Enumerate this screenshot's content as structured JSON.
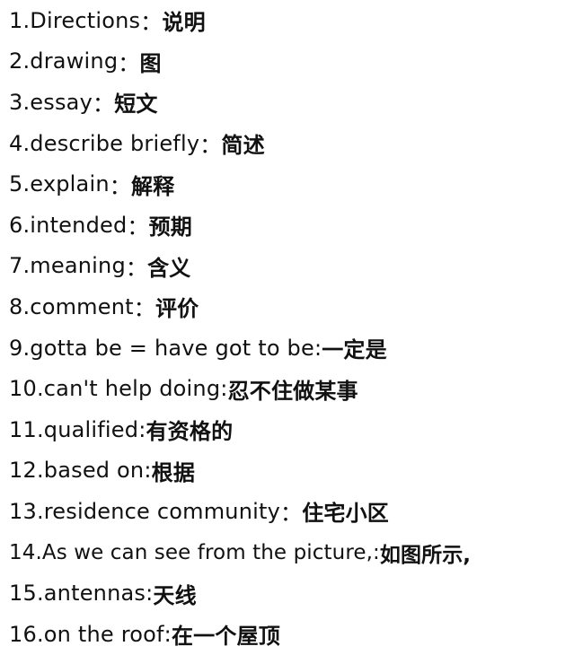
{
  "vocab": [
    {
      "term": "1.Directions",
      "sep": "：",
      "meaning": "说明"
    },
    {
      "term": "2.drawing",
      "sep": "：",
      "meaning": "图"
    },
    {
      "term": "3.essay",
      "sep": "：",
      "meaning": "短文"
    },
    {
      "term": "4.describe briefly",
      "sep": "：",
      "meaning": "简述"
    },
    {
      "term": "5.explain",
      "sep": "：",
      "meaning": "解释"
    },
    {
      "term": "6.intended",
      "sep": "：",
      "meaning": "预期"
    },
    {
      "term": "7.meaning",
      "sep": "：",
      "meaning": "含义"
    },
    {
      "term": "8.comment",
      "sep": "：",
      "meaning": "评价"
    },
    {
      "term": "9.gotta be = have got to be",
      "sep": ":",
      "meaning": "一定是"
    },
    {
      "term": "10.can't help doing",
      "sep": ":",
      "meaning": "忍不住做某事"
    },
    {
      "term": "11.qualified",
      "sep": ":",
      "meaning": "有资格的"
    },
    {
      "term": "12.based on",
      "sep": ":",
      "meaning": "根据"
    },
    {
      "term": "13.residence community",
      "sep": "：",
      "meaning": "住宅小区"
    },
    {
      "term": "14.As we can see from the picture,",
      "sep": ":",
      "meaning": " 如图所示,"
    },
    {
      "term": "15.antennas",
      "sep": ":",
      "meaning": "天线"
    },
    {
      "term": "16.on the roof",
      "sep": ":",
      "meaning": "在一个屋顶"
    }
  ]
}
